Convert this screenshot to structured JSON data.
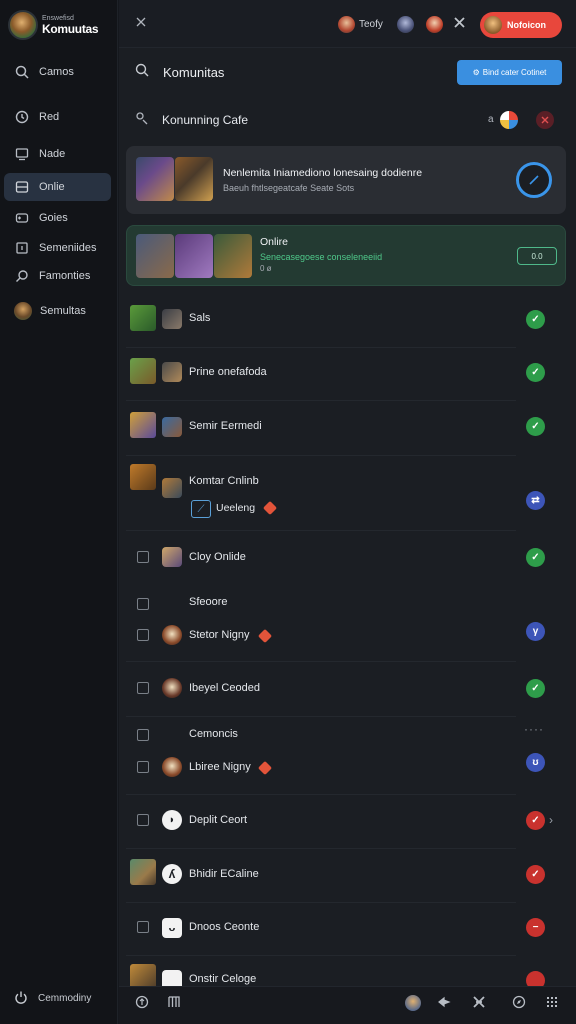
{
  "brand": {
    "subtitle": "Enswefisd",
    "name": "Komuutas"
  },
  "sidebar": {
    "items": [
      {
        "label": "Camos",
        "icon": "search-icon"
      },
      {
        "label": "Red",
        "icon": "clock-icon"
      },
      {
        "label": "Nade",
        "icon": "monitor-icon"
      },
      {
        "label": "Onlie",
        "icon": "card-icon",
        "active": true
      },
      {
        "label": "Goies",
        "icon": "gamepad-icon"
      },
      {
        "label": "Semeniides",
        "icon": "square-icon"
      },
      {
        "label": "Famonties",
        "icon": "search-icon"
      },
      {
        "label": "Semultas",
        "icon": "avatar"
      }
    ],
    "footer": {
      "label": "Cemmodiny",
      "icon": "power-icon"
    }
  },
  "topbar": {
    "toolbar_text": "Teofy",
    "notify_label": "Nofoicon",
    "notify_color": "#e8473c"
  },
  "main": {
    "title": "Komunitas",
    "cta_label": "Bind cater Cotinet",
    "cta_color": "#3a8fe0",
    "section_title": "Konunning Cafe",
    "section_marker": "a"
  },
  "cards": [
    {
      "title": "Nenlemita Iniamediono lonesaing dodienre",
      "subtitle": "Baeuh fhtlsegeatcafe Seate Sots"
    },
    {
      "title": "Onlire",
      "subtitle": "Senecasegoese conseleneeiid",
      "meta": "0 ø",
      "pill": "0.0"
    }
  ],
  "rows": [
    {
      "label": "Sals",
      "status": "green"
    },
    {
      "label": "Prine onefafoda",
      "status": "green"
    },
    {
      "label": "Semir Eermedi",
      "status": "green"
    },
    {
      "label": "Komtar Cnlinb",
      "sublabel": "Ueeleng",
      "status": "blue"
    },
    {
      "label": "Cloy Onlide",
      "status": "green"
    },
    {
      "label": "Sfeoore",
      "status": "none"
    },
    {
      "label": "Stetor Nigny",
      "status": "blue"
    },
    {
      "label": "Ibeyel Ceoded",
      "status": "green"
    },
    {
      "label": "Cemoncis",
      "status": "none"
    },
    {
      "label": "Lbiree Nigny",
      "status": "blue"
    },
    {
      "label": "Deplit Ceort",
      "status": "red"
    },
    {
      "label": "Bhidir ECaline",
      "status": "red"
    },
    {
      "label": "Dnoos Ceonte",
      "status": "red"
    },
    {
      "label": "Onstir Celoge",
      "status": "red"
    }
  ],
  "colors": {
    "status_green": "#2e9d4a",
    "status_blue": "#3d55b8",
    "status_red": "#c9322e"
  }
}
